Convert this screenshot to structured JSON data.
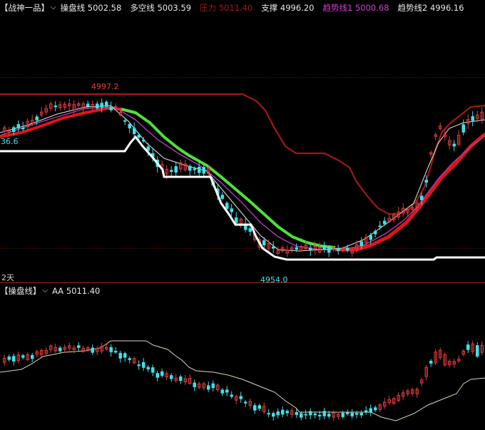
{
  "top_panel": {
    "title": "【战神一品】",
    "caret": "⌵",
    "indicators": [
      {
        "label": "操盘线",
        "value": "5002.58",
        "color": "#e8e8e8"
      },
      {
        "label": "多空线",
        "value": "5003.59",
        "color": "#e8e8e8"
      },
      {
        "label": "压力",
        "value": "5011.40",
        "color": "#a01818"
      },
      {
        "label": "支撑",
        "value": "4996.20",
        "color": "#e8e8e8"
      },
      {
        "label": "趋势线1",
        "value": "5000.68",
        "color": "#d23ed2"
      },
      {
        "label": "趋势线2",
        "value": "4996.16",
        "color": "#e8e8e8"
      }
    ],
    "high_label": "4997.2",
    "low_label": "4954.0",
    "left_price_label": "36.6",
    "left_bottom_label": "2天"
  },
  "bottom_panel": {
    "title": "【操盘线】",
    "caret": "⌵",
    "indicator": {
      "label": "AA",
      "value": "5011.40",
      "color": "#e8e8e8"
    }
  },
  "colors": {
    "background": "#000000",
    "up_candle": "#e23b3b",
    "down_candle": "#3fe0e8",
    "resistance": "#a01818",
    "support": "#ffffff",
    "trend_green": "#4fe03a",
    "trend_red": "#e01515",
    "trend_purple": "#b23ab2",
    "grid": "#7a1515"
  }
}
